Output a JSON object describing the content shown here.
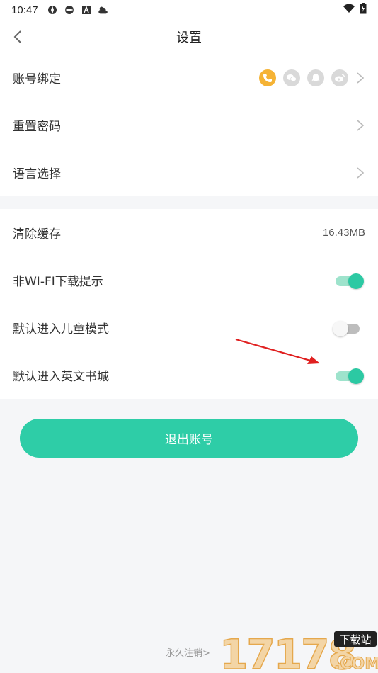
{
  "status_bar": {
    "time": "10:47",
    "left_icons": [
      "aperture-icon",
      "aperture-icon",
      "a-icon",
      "cloud-sun-icon"
    ],
    "right_icons": [
      "wifi-icon",
      "battery-icon"
    ]
  },
  "nav": {
    "title": "设置",
    "back_icon": "chevron-left-icon"
  },
  "section1": [
    {
      "label": "账号绑定",
      "social": [
        "phone-icon",
        "wechat-icon",
        "qq-icon",
        "weibo-icon"
      ],
      "active": "phone-icon"
    },
    {
      "label": "重置密码"
    },
    {
      "label": "语言选择"
    }
  ],
  "section2": {
    "cache": {
      "label": "清除缓存",
      "value": "16.43MB"
    },
    "wifi_prompt": {
      "label": "非WI-FI下载提示",
      "on": true
    },
    "kids_mode": {
      "label": "默认进入儿童模式",
      "on": false
    },
    "english_store": {
      "label": "默认进入英文书城",
      "on": true
    }
  },
  "logout_label": "退出账号",
  "cancel_account": "永久注销>",
  "watermark": {
    "digits": "17178",
    "badge": "下载站",
    "suffix": ".COM"
  },
  "colors": {
    "accent": "#2ecda7",
    "phone_active": "#f5b335",
    "inactive_icon": "#d9d9d9",
    "arrow": "#e02020"
  }
}
